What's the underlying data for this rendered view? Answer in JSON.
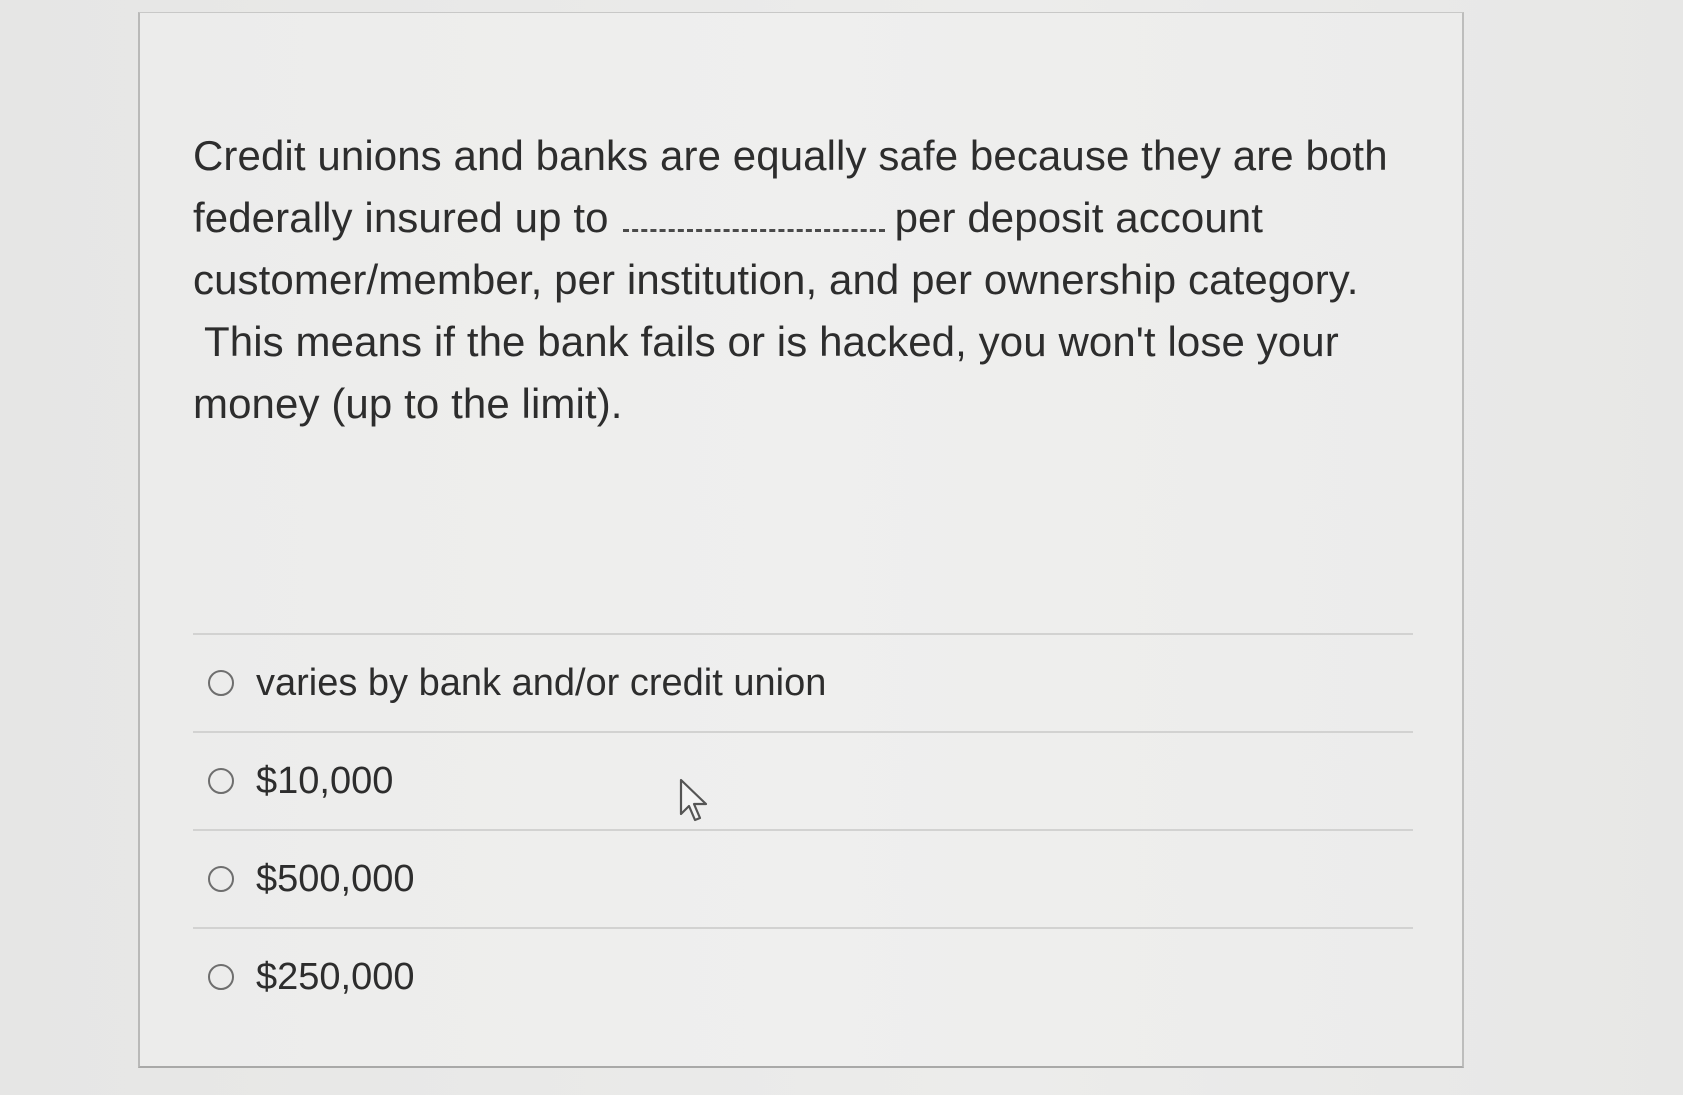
{
  "question": {
    "line1": "Credit unions and banks are equally safe because they are both",
    "line2_before_blank": "federally insured up to",
    "line2_after_blank": "per deposit account",
    "line3": "customer/member, per institution, and per ownership category.",
    "line4": " This means if the bank fails or is hacked, you won't lose your",
    "line5": "money (up to the limit)."
  },
  "choices": [
    {
      "label": "varies by bank and/or credit union",
      "selected": false
    },
    {
      "label": "$10,000",
      "selected": false
    },
    {
      "label": "$500,000",
      "selected": false
    },
    {
      "label": "$250,000",
      "selected": false
    }
  ],
  "icons": {
    "cursor": "mouse-pointer-icon",
    "radio": "radio-button-empty-icon"
  }
}
